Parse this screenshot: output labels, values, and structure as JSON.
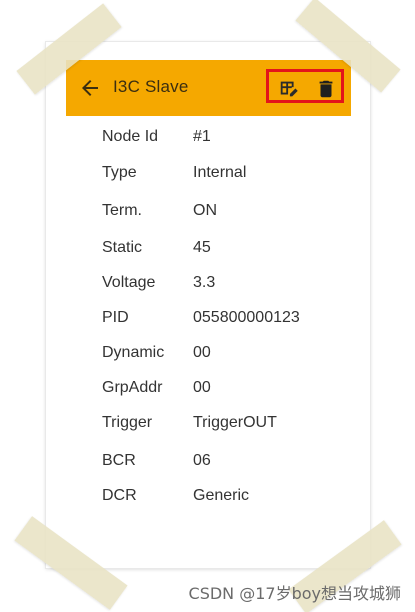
{
  "appbar": {
    "title": "I3C Slave",
    "back_icon": "arrow-back-icon",
    "edit_icon": "edit-table-icon",
    "delete_icon": "trash-icon",
    "highlight_color": "#e3141a",
    "bar_color": "#f5a800"
  },
  "details": [
    {
      "label": "Node Id",
      "value": "#1"
    },
    {
      "label": "Type",
      "value": "Internal"
    },
    {
      "label": "Term.",
      "value": "ON"
    },
    {
      "label": "Static",
      "value": "45"
    },
    {
      "label": "Voltage",
      "value": "3.3"
    },
    {
      "label": "PID",
      "value": "055800000123"
    },
    {
      "label": "Dynamic",
      "value": "00"
    },
    {
      "label": "GrpAddr",
      "value": "00"
    },
    {
      "label": "Trigger",
      "value": "TriggerOUT"
    },
    {
      "label": "BCR",
      "value": "06"
    },
    {
      "label": "DCR",
      "value": "Generic"
    }
  ],
  "watermark": "CSDN @17岁boy想当攻城狮"
}
